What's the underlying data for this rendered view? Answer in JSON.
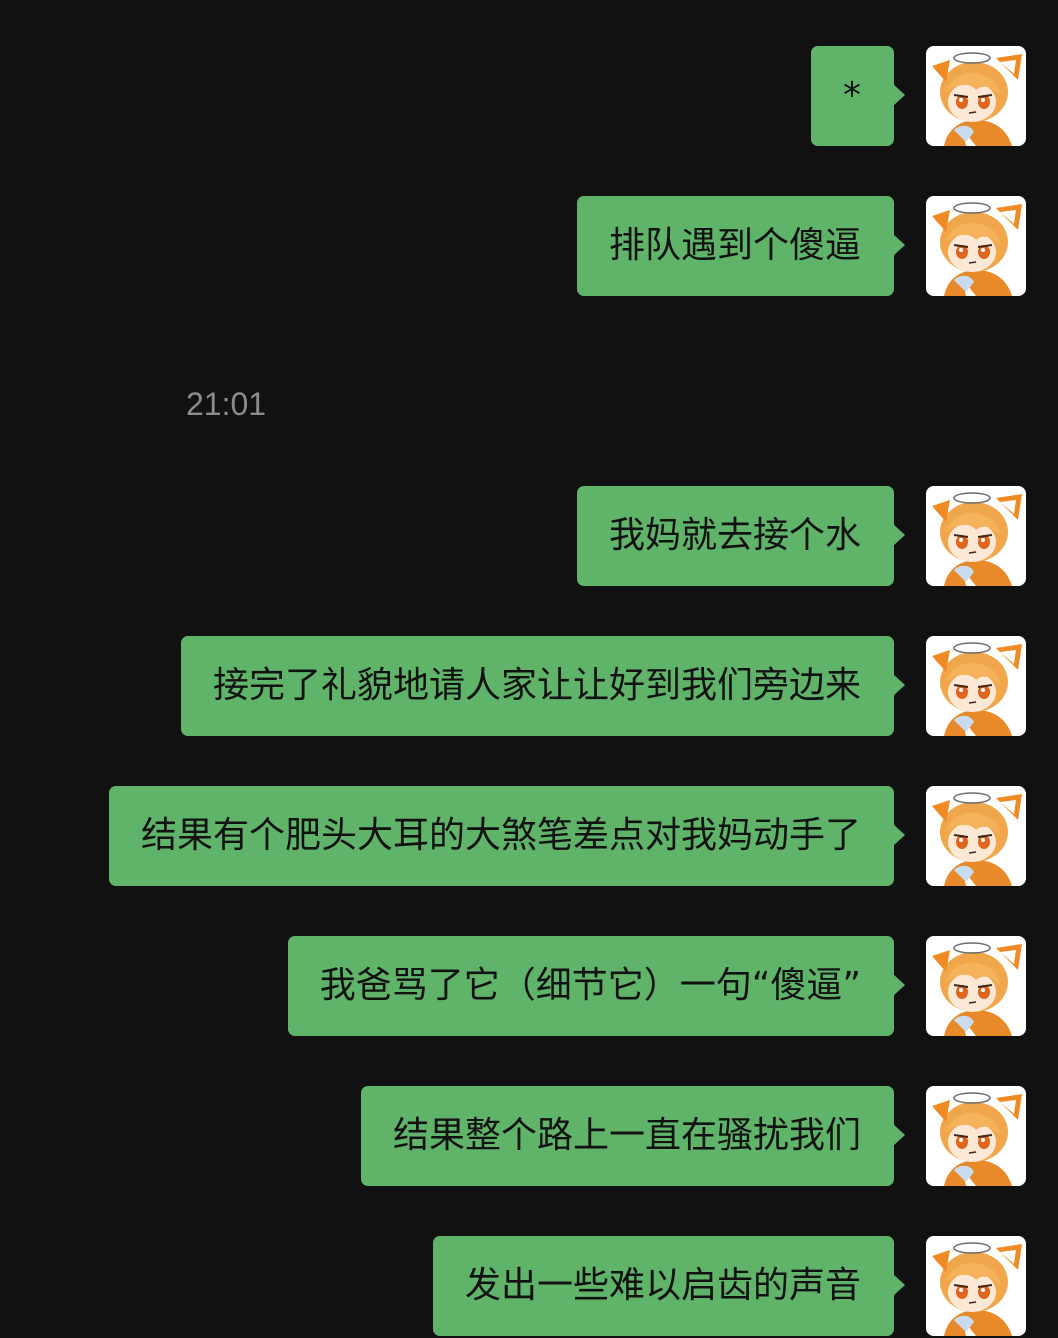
{
  "timestamp": "21:01",
  "messages": [
    {
      "text": "*"
    },
    {
      "text": "排队遇到个傻逼"
    },
    {
      "text": "我妈就去接个水"
    },
    {
      "text": "接完了礼貌地请人家让让好到我们旁边来"
    },
    {
      "text": "结果有个肥头大耳的大煞笔差点对我妈动手了"
    },
    {
      "text": "我爸骂了它（细节它）一句“傻逼”"
    },
    {
      "text": "结果整个路上一直在骚扰我们"
    },
    {
      "text": "发出一些难以启齿的声音"
    }
  ],
  "avatar": {
    "icon": "anime-character-avatar-icon"
  },
  "colors": {
    "background": "#111111",
    "bubble": "#5fb469",
    "bubble_text": "#121212",
    "timestamp_text": "#8c8c8c"
  }
}
